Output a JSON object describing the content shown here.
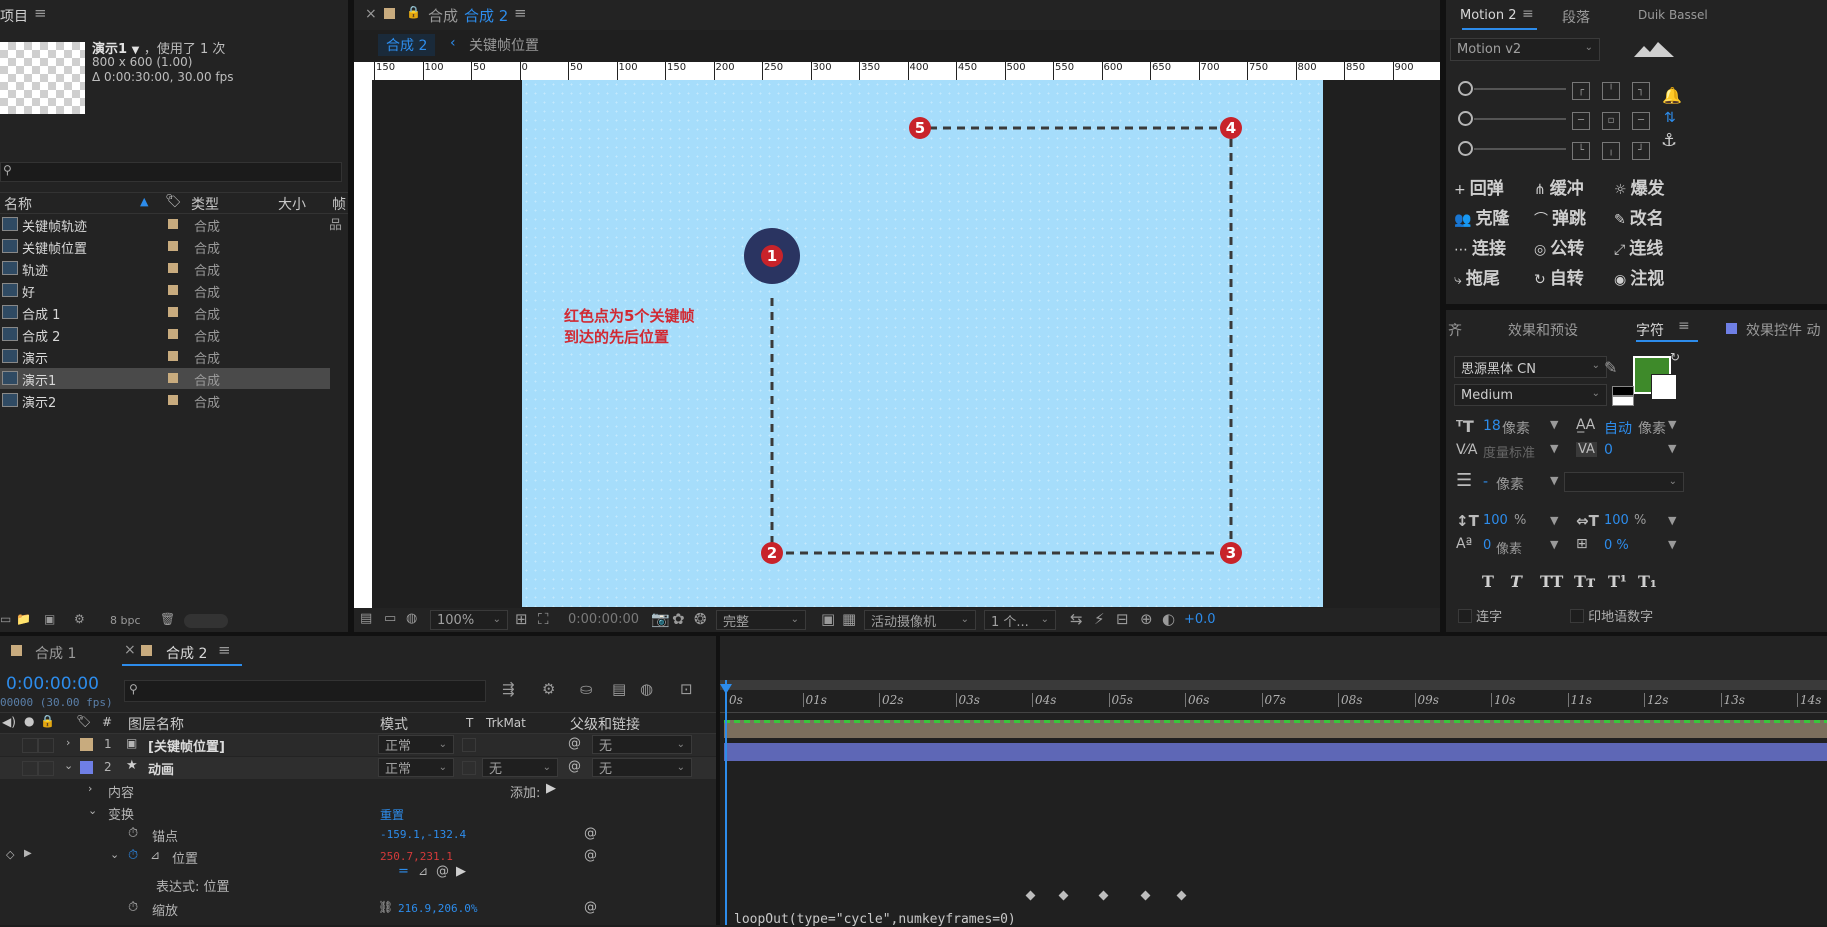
{
  "project": {
    "panel_title": "项目",
    "selected_name": "演示1",
    "used_times": "，使用了 1 次",
    "dimensions": "800 x 600 (1.00)",
    "duration": "Δ 0:00:30:00, 30.00 fps",
    "col_name": "名称",
    "col_type": "类型",
    "col_size": "大小",
    "col_frame": "帧",
    "items": [
      {
        "name": "关键帧轨迹",
        "type": "合成"
      },
      {
        "name": "关键帧位置",
        "type": "合成"
      },
      {
        "name": "轨迹",
        "type": "合成"
      },
      {
        "name": "好",
        "type": "合成"
      },
      {
        "name": "合成 1",
        "type": "合成"
      },
      {
        "name": "合成 2",
        "type": "合成"
      },
      {
        "name": "演示",
        "type": "合成"
      },
      {
        "name": "演示1",
        "type": "合成"
      },
      {
        "name": "演示2",
        "type": "合成"
      }
    ],
    "bpc": "8 bpc"
  },
  "comp": {
    "tab_prefix": "合成",
    "tab_name": "合成 2",
    "crumb_1": "合成 2",
    "crumb_2": "关键帧位置",
    "ruler_labels": [
      "150",
      "100",
      "50",
      "0",
      "50",
      "100",
      "150",
      "200",
      "250",
      "300",
      "350",
      "400",
      "450",
      "500",
      "550",
      "600",
      "650",
      "700",
      "750",
      "800",
      "850",
      "900"
    ],
    "annotation_line1": "红色点为5个关键帧",
    "annotation_line2": "到达的先后位置",
    "points": [
      "1",
      "2",
      "3",
      "4",
      "5"
    ],
    "zoom": "100%",
    "timecode": "0:00:00:00",
    "quality": "完整",
    "camera": "活动摄像机",
    "views": "1 个...",
    "exposure": "+0.0"
  },
  "right_top": {
    "tabs": [
      "Motion 2",
      "段落",
      "Duik Bassel"
    ],
    "version": "Motion v2",
    "buttons": [
      "回弹",
      "缓冲",
      "爆发",
      "克隆",
      "弹跳",
      "改名",
      "连接",
      "公转",
      "连线",
      "拖尾",
      "自转",
      "注视"
    ]
  },
  "character": {
    "tabs": [
      "齐",
      "效果和预设",
      "字符",
      "效果控件 动"
    ],
    "font": "思源黑体 CN",
    "style": "Medium",
    "size_val": "18",
    "size_unit": "像素",
    "leading_val": "自动",
    "leading_unit": "像素",
    "kerning": "度量标准",
    "tracking": "0",
    "stroke_val": "-",
    "stroke_unit": "像素",
    "vscale": "100",
    "hscale": "100",
    "pct": "%",
    "baseline_val": "0",
    "baseline_unit": "像素",
    "tsume": "0 %",
    "ligature": "连字",
    "hindi": "印地语数字",
    "fill_color": "#3e8a2a"
  },
  "timeline": {
    "tabs": [
      "合成 1",
      "合成 2"
    ],
    "timecode": "0:00:00:00",
    "fps": "00000 (30.00 fps)",
    "col_layer": "图层名称",
    "col_mode": "模式",
    "col_t": "T",
    "col_trkmat": "TrkMat",
    "col_parent": "父级和链接",
    "layers": [
      {
        "num": "1",
        "name": "[关键帧位置]",
        "mode": "正常",
        "trkmat": "",
        "parent": "无"
      },
      {
        "num": "2",
        "name": "动画",
        "mode": "正常",
        "trkmat": "无",
        "parent": "无"
      }
    ],
    "contents": "内容",
    "add": "添加:",
    "transform": "变换",
    "reset": "重置",
    "anchor": "锚点",
    "anchor_val": "-159.1,-132.4",
    "position": "位置",
    "position_val": "250.7,231.1",
    "expression_label": "表达式: 位置",
    "scale": "缩放",
    "scale_val": "216.9,206.0%",
    "expression": "loopOut(type=\"cycle\",numkeyframes=0)",
    "ticks": [
      "0s",
      "01s",
      "02s",
      "03s",
      "04s",
      "05s",
      "06s",
      "07s",
      "08s",
      "09s",
      "10s",
      "11s",
      "12s",
      "13s",
      "14s"
    ]
  }
}
